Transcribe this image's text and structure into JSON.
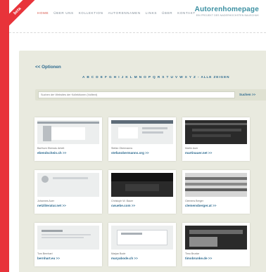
{
  "beta_label": "beta",
  "nav": [
    "HOME",
    "ÜBER UNS",
    "KOLLEKTION",
    "AUTORENNAMEN",
    "LINKS",
    "ÜBER",
    "KONTAKT"
  ],
  "brand": {
    "logo": "Autorenhomepage",
    "tagline": "EIN PROJEKT DES NADERHOCHSTEN BAUSCHUK"
  },
  "options_label": "<< Optionen",
  "alphabet": "A B C D E F G H I J K L M N O P Q R S T U V W X Y Z - ALLE ZEIGEN",
  "search": {
    "placeholder": "Suchen der Websites der Kollektionen (Volltext)",
    "button": "Suchen >>"
  },
  "cards": [
    {
      "name": "Barthurn Ebersdu Arbeit",
      "link": "ebendschein.ch >>"
    },
    {
      "name": "Stefan Obermanns",
      "link": "stefanobermanns.org >>"
    },
    {
      "name": "Martin Auer",
      "link": "martinauer.net >>"
    },
    {
      "name": "Johannes Auer",
      "link": "netzliteratur.net >>"
    },
    {
      "name": "Christoph W. Bauer",
      "link": "cwuebe.com >>"
    },
    {
      "name": "Clemens Berger",
      "link": "clemensberger.at >>"
    },
    {
      "name": "Tom Bernhart",
      "link": "bernhart.eu >>"
    },
    {
      "name": "Marjan Bode",
      "link": "maryabode.ch >>"
    },
    {
      "name": "Timo Brunke",
      "link": "timobrunke.de >>"
    }
  ]
}
